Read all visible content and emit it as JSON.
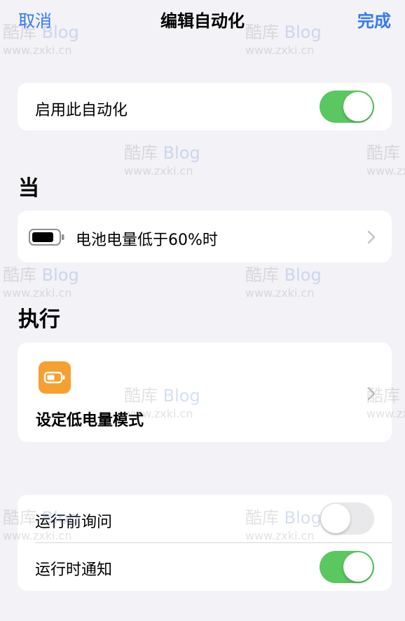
{
  "nav": {
    "cancel_label": "取消",
    "title": "编辑自动化",
    "done_label": "完成"
  },
  "enable_row": {
    "label": "启用此自动化",
    "toggle_on": true
  },
  "when": {
    "header": "当",
    "trigger_label": "电池电量低于60%时",
    "battery_icon": "battery-icon"
  },
  "execute": {
    "header": "执行",
    "action_label": "设定低电量模式",
    "action_icon": "low-power-mode-icon",
    "action_icon_color": "#f5a031"
  },
  "options": [
    {
      "label": "运行前询问",
      "toggle_on": false
    },
    {
      "label": "运行时通知",
      "toggle_on": true
    }
  ],
  "colors": {
    "accent": "#3478f6",
    "toggle_on": "#5bc761",
    "toggle_off": "#e9e9eb",
    "background": "#f2f2f7"
  },
  "watermark": {
    "brand_cn": "酷库",
    "brand_en": "Blog",
    "url": "www.zxki.cn"
  }
}
